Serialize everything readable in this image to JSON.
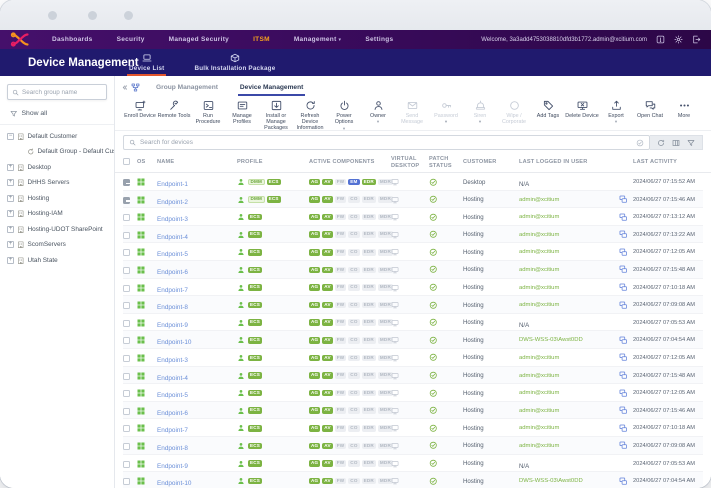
{
  "colors": {
    "nav_purple": "#3a0b5d",
    "page_navy": "#201a6e",
    "active_orange": "#f5a01e",
    "tab_underline_red": "#e2552d",
    "subtab_underline_blue": "#3b49a8",
    "green": "#7cb342",
    "link_blue": "#6b8fd8"
  },
  "nav": {
    "items": [
      {
        "label": "Dashboards"
      },
      {
        "label": "Security"
      },
      {
        "label": "Managed Security"
      },
      {
        "label": "ITSM",
        "active": true
      },
      {
        "label": "Management",
        "caret": true
      },
      {
        "label": "Settings"
      }
    ],
    "welcome": "Welcome, 3a3add4753038810dfd3b1772.admin@xcitium.com",
    "icons": [
      "release-notes-icon",
      "gear-icon",
      "logout-icon"
    ]
  },
  "page": {
    "title": "Device Management",
    "tabs": [
      {
        "label": "Device List",
        "icon": "devicelist",
        "active": true
      },
      {
        "label": "Bulk Installation Package",
        "icon": "package-box",
        "active": false
      }
    ]
  },
  "sidebar": {
    "search_placeholder": "Search group name",
    "show_all": "Show all",
    "items": [
      {
        "label": "Default Customer",
        "exp": "minus",
        "icon": "building",
        "child": false
      },
      {
        "label": "Default Group - Default Cus...",
        "exp": "none",
        "icon": "loop",
        "child": true
      },
      {
        "label": "Desktop",
        "exp": "plus",
        "icon": "building",
        "child": false
      },
      {
        "label": "DHHS Servers",
        "exp": "plus",
        "icon": "building",
        "child": false
      },
      {
        "label": "Hosting",
        "exp": "plus",
        "icon": "building",
        "child": false
      },
      {
        "label": "Hosting-IAM",
        "exp": "plus",
        "icon": "building",
        "child": false
      },
      {
        "label": "Hosting-UDOT SharePoint",
        "exp": "plus",
        "icon": "building",
        "child": false
      },
      {
        "label": "ScomServers",
        "exp": "plus",
        "icon": "building",
        "child": false
      },
      {
        "label": "Utah State",
        "exp": "plus",
        "icon": "building",
        "child": false
      }
    ]
  },
  "main": {
    "tabs": [
      {
        "label": "Group Management",
        "active": false
      },
      {
        "label": "Device Management",
        "active": true
      }
    ],
    "toolbar": [
      {
        "label": "Enroll Device",
        "icon": "enroll",
        "enabled": true,
        "caret": false
      },
      {
        "label": "Remote Tools",
        "icon": "tools",
        "enabled": true,
        "caret": false
      },
      {
        "label": "Run Procedure",
        "icon": "procedure",
        "enabled": true,
        "caret": false
      },
      {
        "label": "Manage Profiles",
        "icon": "profiles",
        "enabled": true,
        "caret": false
      },
      {
        "label": "Install or Manage Packages",
        "icon": "package",
        "enabled": true,
        "caret": false
      },
      {
        "label": "Refresh Device Information",
        "icon": "refresh",
        "enabled": true,
        "caret": false
      },
      {
        "label": "Power Options",
        "icon": "power",
        "enabled": true,
        "caret": true
      },
      {
        "label": "Owner",
        "icon": "owner",
        "enabled": true,
        "caret": true
      },
      {
        "label": "Send Message",
        "icon": "mail",
        "enabled": false,
        "caret": false
      },
      {
        "label": "Password",
        "icon": "key",
        "enabled": false,
        "caret": true
      },
      {
        "label": "Siren",
        "icon": "siren",
        "enabled": false,
        "caret": true
      },
      {
        "label": "Wipe / Corporate",
        "icon": "wipe",
        "enabled": false,
        "caret": false
      },
      {
        "label": "Add Tags",
        "icon": "tag",
        "enabled": true,
        "caret": false
      },
      {
        "label": "Delete Device",
        "icon": "delete",
        "enabled": true,
        "caret": false
      },
      {
        "label": "Export",
        "icon": "export",
        "enabled": true,
        "caret": true
      },
      {
        "label": "Open Chat",
        "icon": "chat",
        "enabled": true,
        "caret": false
      },
      {
        "label": "More",
        "icon": "more",
        "enabled": true,
        "caret": false
      }
    ],
    "search_placeholder": "Search for devices",
    "search_action_icons": [
      "refresh-icon",
      "columns-icon",
      "filter-icon"
    ],
    "table": {
      "columns": [
        "OS",
        "NAME",
        "PROFILE",
        "ACTIVE COMPONENTS",
        "VIRTUAL DESKTOP",
        "PATCH STATUS",
        "CUSTOMER",
        "LAST LOGGED IN USER",
        "LAST ACTIVITY"
      ],
      "rows": [
        {
          "name": "Endpoint-1",
          "checked": true,
          "profile": [
            [
              "DMM",
              "o"
            ],
            [
              "ECS",
              "g"
            ]
          ],
          "components": [
            [
              "AG",
              "g"
            ],
            [
              "AV",
              "g"
            ],
            [
              "FW",
              "x"
            ],
            [
              "EM",
              "b"
            ],
            [
              "EDR",
              "g"
            ],
            [
              "MDR",
              "x"
            ]
          ],
          "customer": "Desktop",
          "user": "N/A",
          "user_link": false,
          "remote": false,
          "activity": "2024/06/27 07:15:52 AM"
        },
        {
          "name": "Endpoint-2",
          "checked": true,
          "profile": [
            [
              "DMM",
              "o"
            ],
            [
              "ECS",
              "g"
            ]
          ],
          "components": [
            [
              "AG",
              "g"
            ],
            [
              "AV",
              "g"
            ],
            [
              "FW",
              "x"
            ],
            [
              "CO",
              "x"
            ],
            [
              "EDR",
              "x"
            ],
            [
              "MDR",
              "x"
            ]
          ],
          "customer": "Hosting",
          "user": "admin@xcitium",
          "user_link": true,
          "remote": true,
          "activity": "2024/06/27 07:15:46 AM"
        },
        {
          "name": "Endpoint-3",
          "checked": false,
          "profile": [
            [
              "ECS",
              "g"
            ]
          ],
          "components": [
            [
              "AG",
              "g"
            ],
            [
              "AV",
              "g"
            ],
            [
              "FW",
              "x"
            ],
            [
              "CO",
              "x"
            ],
            [
              "EDR",
              "x"
            ],
            [
              "MDR",
              "x"
            ]
          ],
          "customer": "Hosting",
          "user": "admin@xcitium",
          "user_link": true,
          "remote": true,
          "activity": "2024/06/27 07:13:12 AM"
        },
        {
          "name": "Endpoint-4",
          "checked": false,
          "profile": [
            [
              "ECS",
              "g"
            ]
          ],
          "components": [
            [
              "AG",
              "g"
            ],
            [
              "AV",
              "g"
            ],
            [
              "FW",
              "x"
            ],
            [
              "CO",
              "x"
            ],
            [
              "EDR",
              "x"
            ],
            [
              "MDR",
              "x"
            ]
          ],
          "customer": "Hosting",
          "user": "admin@xcitium",
          "user_link": true,
          "remote": true,
          "activity": "2024/06/27 07:13:22 AM"
        },
        {
          "name": "Endpoint-5",
          "checked": false,
          "profile": [
            [
              "ECS",
              "g"
            ]
          ],
          "components": [
            [
              "AG",
              "g"
            ],
            [
              "AV",
              "g"
            ],
            [
              "FW",
              "x"
            ],
            [
              "CO",
              "x"
            ],
            [
              "EDR",
              "x"
            ],
            [
              "MDR",
              "x"
            ]
          ],
          "customer": "Hosting",
          "user": "admin@xcitium",
          "user_link": true,
          "remote": true,
          "activity": "2024/06/27 07:12:05 AM"
        },
        {
          "name": "Endpoint-6",
          "checked": false,
          "profile": [
            [
              "ECS",
              "g"
            ]
          ],
          "components": [
            [
              "AG",
              "g"
            ],
            [
              "AV",
              "g"
            ],
            [
              "FW",
              "x"
            ],
            [
              "CO",
              "x"
            ],
            [
              "EDR",
              "x"
            ],
            [
              "MDR",
              "x"
            ]
          ],
          "customer": "Hosting",
          "user": "admin@xcitium",
          "user_link": true,
          "remote": true,
          "activity": "2024/06/27 07:15:48 AM"
        },
        {
          "name": "Endpoint-7",
          "checked": false,
          "profile": [
            [
              "ECS",
              "g"
            ]
          ],
          "components": [
            [
              "AG",
              "g"
            ],
            [
              "AV",
              "g"
            ],
            [
              "FW",
              "x"
            ],
            [
              "CO",
              "x"
            ],
            [
              "EDR",
              "x"
            ],
            [
              "MDR",
              "x"
            ]
          ],
          "customer": "Hosting",
          "user": "admin@xcitium",
          "user_link": true,
          "remote": true,
          "activity": "2024/06/27 07:10:18 AM"
        },
        {
          "name": "Endpoint-8",
          "checked": false,
          "profile": [
            [
              "ECS",
              "g"
            ]
          ],
          "components": [
            [
              "AG",
              "g"
            ],
            [
              "AV",
              "g"
            ],
            [
              "FW",
              "x"
            ],
            [
              "CO",
              "x"
            ],
            [
              "EDR",
              "x"
            ],
            [
              "MDR",
              "x"
            ]
          ],
          "customer": "Hosting",
          "user": "admin@xcitium",
          "user_link": true,
          "remote": true,
          "activity": "2024/06/27 07:09:08 AM"
        },
        {
          "name": "Endpoint-9",
          "checked": false,
          "profile": [
            [
              "ECS",
              "g"
            ]
          ],
          "components": [
            [
              "AG",
              "g"
            ],
            [
              "AV",
              "g"
            ],
            [
              "FW",
              "x"
            ],
            [
              "CO",
              "x"
            ],
            [
              "EDR",
              "x"
            ],
            [
              "MDR",
              "x"
            ]
          ],
          "customer": "Hosting",
          "user": "N/A",
          "user_link": false,
          "remote": false,
          "activity": "2024/06/27 07:05:53 AM"
        },
        {
          "name": "Endpoint-10",
          "checked": false,
          "profile": [
            [
              "ECS",
              "g"
            ]
          ],
          "components": [
            [
              "AG",
              "g"
            ],
            [
              "AV",
              "g"
            ],
            [
              "FW",
              "x"
            ],
            [
              "CO",
              "x"
            ],
            [
              "EDR",
              "x"
            ],
            [
              "MDR",
              "x"
            ]
          ],
          "customer": "Hosting",
          "user": "DWS-WSS-03\\Awst0DD",
          "user_link": true,
          "remote": true,
          "activity": "2024/06/27 07:04:54 AM"
        },
        {
          "name": "Endpoint-3",
          "checked": false,
          "profile": [
            [
              "ECS",
              "g"
            ]
          ],
          "components": [
            [
              "AG",
              "g"
            ],
            [
              "AV",
              "g"
            ],
            [
              "FW",
              "x"
            ],
            [
              "CO",
              "x"
            ],
            [
              "EDR",
              "x"
            ],
            [
              "MDR",
              "x"
            ]
          ],
          "customer": "Hosting",
          "user": "admin@xcitium",
          "user_link": true,
          "remote": true,
          "activity": "2024/06/27 07:12:05 AM"
        },
        {
          "name": "Endpoint-4",
          "checked": false,
          "profile": [
            [
              "ECS",
              "g"
            ]
          ],
          "components": [
            [
              "AG",
              "g"
            ],
            [
              "AV",
              "g"
            ],
            [
              "FW",
              "x"
            ],
            [
              "CO",
              "x"
            ],
            [
              "EDR",
              "x"
            ],
            [
              "MDR",
              "x"
            ]
          ],
          "customer": "Hosting",
          "user": "admin@xcitium",
          "user_link": true,
          "remote": true,
          "activity": "2024/06/27 07:15:48 AM"
        },
        {
          "name": "Endpoint-5",
          "checked": false,
          "profile": [
            [
              "ECS",
              "g"
            ]
          ],
          "components": [
            [
              "AG",
              "g"
            ],
            [
              "AV",
              "g"
            ],
            [
              "FW",
              "x"
            ],
            [
              "CO",
              "x"
            ],
            [
              "EDR",
              "x"
            ],
            [
              "MDR",
              "x"
            ]
          ],
          "customer": "Hosting",
          "user": "admin@xcitium",
          "user_link": true,
          "remote": true,
          "activity": "2024/06/27 07:12:05 AM"
        },
        {
          "name": "Endpoint-6",
          "checked": false,
          "profile": [
            [
              "ECS",
              "g"
            ]
          ],
          "components": [
            [
              "AG",
              "g"
            ],
            [
              "AV",
              "g"
            ],
            [
              "FW",
              "x"
            ],
            [
              "CO",
              "x"
            ],
            [
              "EDR",
              "x"
            ],
            [
              "MDR",
              "x"
            ]
          ],
          "customer": "Hosting",
          "user": "admin@xcitium",
          "user_link": true,
          "remote": true,
          "activity": "2024/06/27 07:15:46 AM"
        },
        {
          "name": "Endpoint-7",
          "checked": false,
          "profile": [
            [
              "ECS",
              "g"
            ]
          ],
          "components": [
            [
              "AG",
              "g"
            ],
            [
              "AV",
              "g"
            ],
            [
              "FW",
              "x"
            ],
            [
              "CO",
              "x"
            ],
            [
              "EDR",
              "x"
            ],
            [
              "MDR",
              "x"
            ]
          ],
          "customer": "Hosting",
          "user": "admin@xcitium",
          "user_link": true,
          "remote": true,
          "activity": "2024/06/27 07:10:18 AM"
        },
        {
          "name": "Endpoint-8",
          "checked": false,
          "profile": [
            [
              "ECS",
              "g"
            ]
          ],
          "components": [
            [
              "AG",
              "g"
            ],
            [
              "AV",
              "g"
            ],
            [
              "FW",
              "x"
            ],
            [
              "CO",
              "x"
            ],
            [
              "EDR",
              "x"
            ],
            [
              "MDR",
              "x"
            ]
          ],
          "customer": "Hosting",
          "user": "admin@xcitium",
          "user_link": true,
          "remote": true,
          "activity": "2024/06/27 07:09:08 AM"
        },
        {
          "name": "Endpoint-9",
          "checked": false,
          "profile": [
            [
              "ECS",
              "g"
            ]
          ],
          "components": [
            [
              "AG",
              "g"
            ],
            [
              "AV",
              "g"
            ],
            [
              "FW",
              "x"
            ],
            [
              "CO",
              "x"
            ],
            [
              "EDR",
              "x"
            ],
            [
              "MDR",
              "x"
            ]
          ],
          "customer": "Hosting",
          "user": "N/A",
          "user_link": false,
          "remote": false,
          "activity": "2024/06/27 07:05:53 AM"
        },
        {
          "name": "Endpoint-10",
          "checked": false,
          "profile": [
            [
              "ECS",
              "g"
            ]
          ],
          "components": [
            [
              "AG",
              "g"
            ],
            [
              "AV",
              "g"
            ],
            [
              "FW",
              "x"
            ],
            [
              "CO",
              "x"
            ],
            [
              "EDR",
              "x"
            ],
            [
              "MDR",
              "x"
            ]
          ],
          "customer": "Hosting",
          "user": "DWS-WSS-03\\Awst0DD",
          "user_link": true,
          "remote": true,
          "activity": "2024/06/27 07:04:54 AM"
        }
      ]
    }
  }
}
